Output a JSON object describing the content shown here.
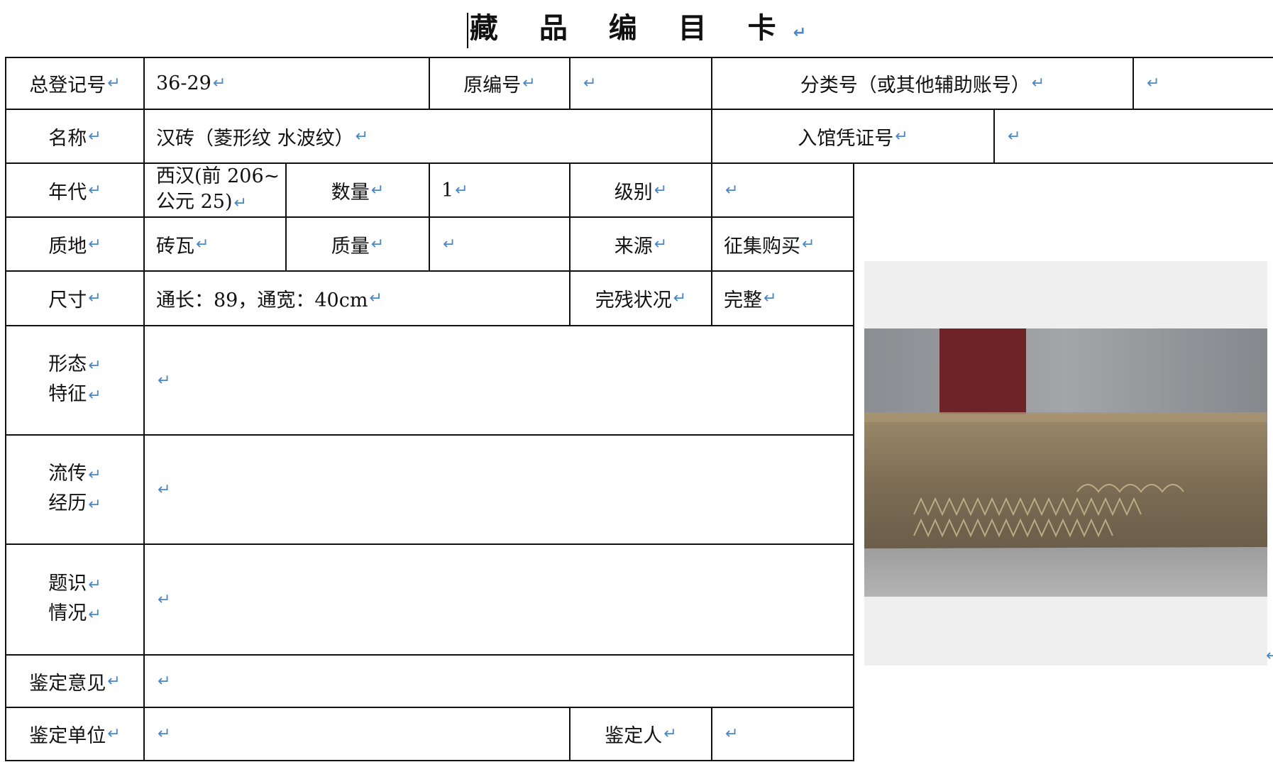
{
  "title": "藏 品 编 目 卡",
  "return_mark": "↵",
  "fields": {
    "total_reg_no": {
      "label": "总登记号",
      "value": "36-29"
    },
    "original_no": {
      "label": "原编号",
      "value": ""
    },
    "class_no": {
      "label": "分类号（或其他辅助账号）",
      "value": ""
    },
    "name": {
      "label": "名称",
      "value": "汉砖（菱形纹 水波纹）"
    },
    "entry_voucher_no": {
      "label": "入馆凭证号",
      "value": ""
    },
    "era": {
      "label": "年代",
      "value_line1": "西汉(前 206~",
      "value_line2": "公元 25)"
    },
    "quantity": {
      "label": "数量",
      "value": "1"
    },
    "grade": {
      "label": "级别",
      "value": ""
    },
    "material": {
      "label": "质地",
      "value": "砖瓦"
    },
    "mass": {
      "label": "质量",
      "value": ""
    },
    "source": {
      "label": "来源",
      "value": "征集购买"
    },
    "size": {
      "label": "尺寸",
      "value": "通长：89，通宽：40cm"
    },
    "condition": {
      "label": "完残状况",
      "value": "完整"
    },
    "form": {
      "label_line1": "形态",
      "label_line2": "特征",
      "value": ""
    },
    "provenance": {
      "label_line1": "流传",
      "label_line2": "经历",
      "value": ""
    },
    "inscription": {
      "label_line1": "题识",
      "label_line2": "情况",
      "value": ""
    },
    "appraisal_opinion": {
      "label": "鉴定意见",
      "value": ""
    },
    "appraisal_unit": {
      "label": "鉴定单位",
      "value": ""
    },
    "appraiser": {
      "label": "鉴定人",
      "value": ""
    }
  },
  "colors": {
    "return_mark": "#4a86c8",
    "grid_line": "#111111"
  }
}
